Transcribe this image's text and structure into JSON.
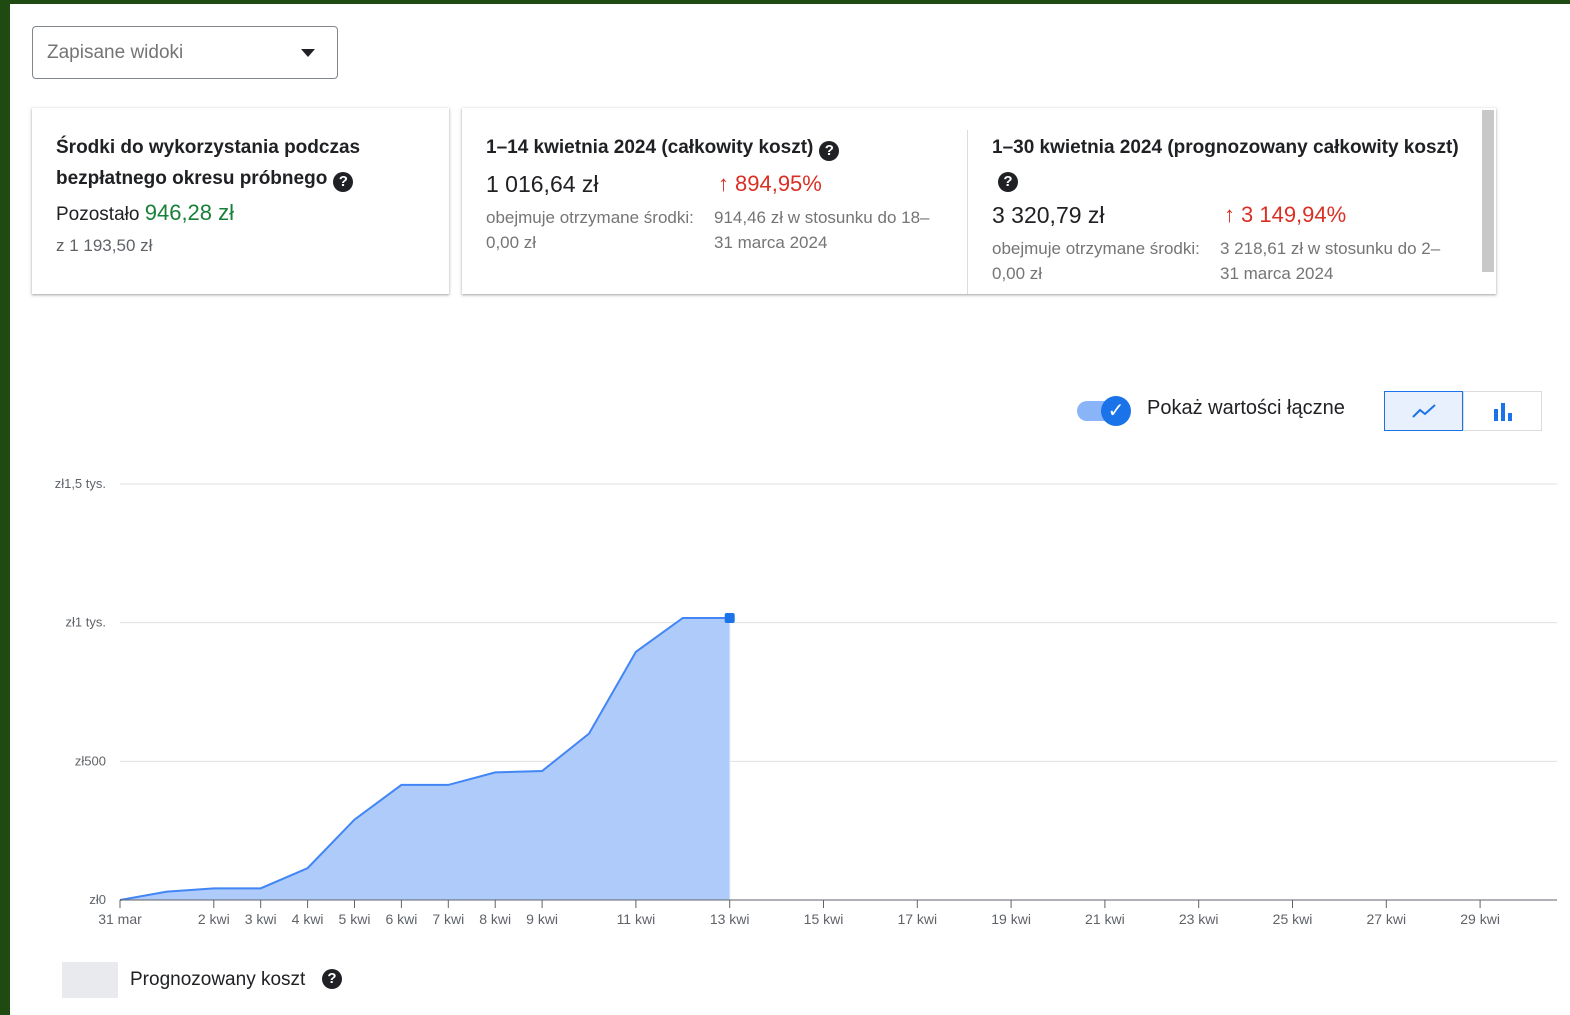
{
  "saved_views": {
    "placeholder": "Zapisane widoki"
  },
  "card_trial": {
    "title": "Środki do wykorzystania podczas bezpłatnego okresu próbnego",
    "remaining_label": "Pozostało",
    "remaining_value": "946,28 zł",
    "total": "z 1 193,50 zł"
  },
  "card_actual": {
    "title": "1–14 kwietnia 2024 (całkowity koszt)",
    "value": "1 016,64 zł",
    "change": "894,95%",
    "note": "obejmuje otrzymane środki: 0,00 zł",
    "comparison": "914,46 zł w stosunku do 18–31 marca 2024"
  },
  "card_forecast": {
    "title": "1–30 kwietnia 2024 (prognozowany całkowity koszt)",
    "value": "3 320,79 zł",
    "change": "3 149,94%",
    "note": "obejmuje otrzymane środki: 0,00 zł",
    "comparison": "3 218,61 zł w stosunku do 2–31 marca 2024"
  },
  "toggle": {
    "label": "Pokaż wartości łączne",
    "on": true
  },
  "view_switch": {
    "selected": "line",
    "options": [
      "line-chart-icon",
      "bar-chart-icon"
    ]
  },
  "legend": {
    "label": "Prognozowany koszt"
  },
  "colors": {
    "area": "#aecbfa",
    "line": "#4285f4",
    "accent": "#1a73e8",
    "negative": "#d93025",
    "positive": "#188038"
  },
  "chart_data": {
    "type": "area",
    "y_ticks": [
      "zł0",
      "zł500",
      "zł1 tys.",
      "zł1,5 tys."
    ],
    "ylim": [
      0,
      1500
    ],
    "x_tick_labels": [
      "31 mar",
      "2 kwi",
      "3 kwi",
      "4 kwi",
      "5 kwi",
      "6 kwi",
      "7 kwi",
      "8 kwi",
      "9 kwi",
      "11 kwi",
      "13 kwi",
      "15 kwi",
      "17 kwi",
      "19 kwi",
      "21 kwi",
      "23 kwi",
      "25 kwi",
      "27 kwi",
      "29 kwi"
    ],
    "x": [
      "31 mar",
      "1 kwi",
      "2 kwi",
      "3 kwi",
      "4 kwi",
      "5 kwi",
      "6 kwi",
      "7 kwi",
      "8 kwi",
      "9 kwi",
      "10 kwi",
      "11 kwi",
      "12 kwi",
      "13 kwi"
    ],
    "series": [
      {
        "values": [
          0,
          30,
          42,
          42,
          115,
          290,
          415,
          415,
          460,
          465,
          600,
          895,
          1017,
          1017
        ]
      }
    ],
    "xlim": [
      "31 mar",
      "30 kwi"
    ],
    "grid": true
  }
}
